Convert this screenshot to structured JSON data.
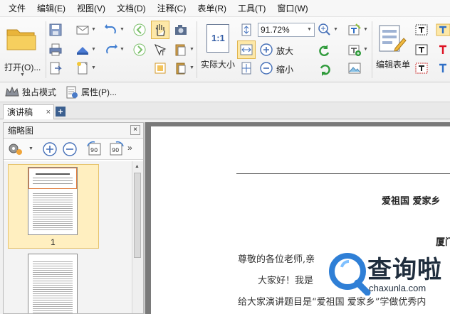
{
  "menu": [
    "文件",
    "编辑(E)",
    "视图(V)",
    "文档(D)",
    "注释(C)",
    "表单(R)",
    "工具(T)",
    "窗口(W)"
  ],
  "ribbon": {
    "open_label": "打开(O)...",
    "actual_size_label": "实际大小",
    "zoom_value": "91.72%",
    "zoom_in_label": "放大",
    "zoom_out_label": "缩小",
    "edit_form_label": "编辑表单",
    "actual_size_icon_text": "1:1"
  },
  "subbar": {
    "exclusive_mode": "独占模式",
    "properties": "属性(P)..."
  },
  "doc_tab": {
    "label": "演讲稿",
    "close": "×",
    "add": "+"
  },
  "thumbnail_pane": {
    "title": "缩略图",
    "close": "×",
    "page1": "1"
  },
  "document": {
    "title": "爱祖国 爱家乡",
    "subtitle": "厦门",
    "line1": "尊敬的各位老师,亲",
    "line2": "大家好！我是",
    "line3": "给大家演讲题目是“爱祖国 爱家乡”学做优秀内"
  },
  "watermark": {
    "brand": "查询啦",
    "url": "chaxunla.com"
  },
  "colors": {
    "accent": "#3b5f8f",
    "selection": "#ffefc0",
    "logo_blue": "#2f7fd6"
  }
}
